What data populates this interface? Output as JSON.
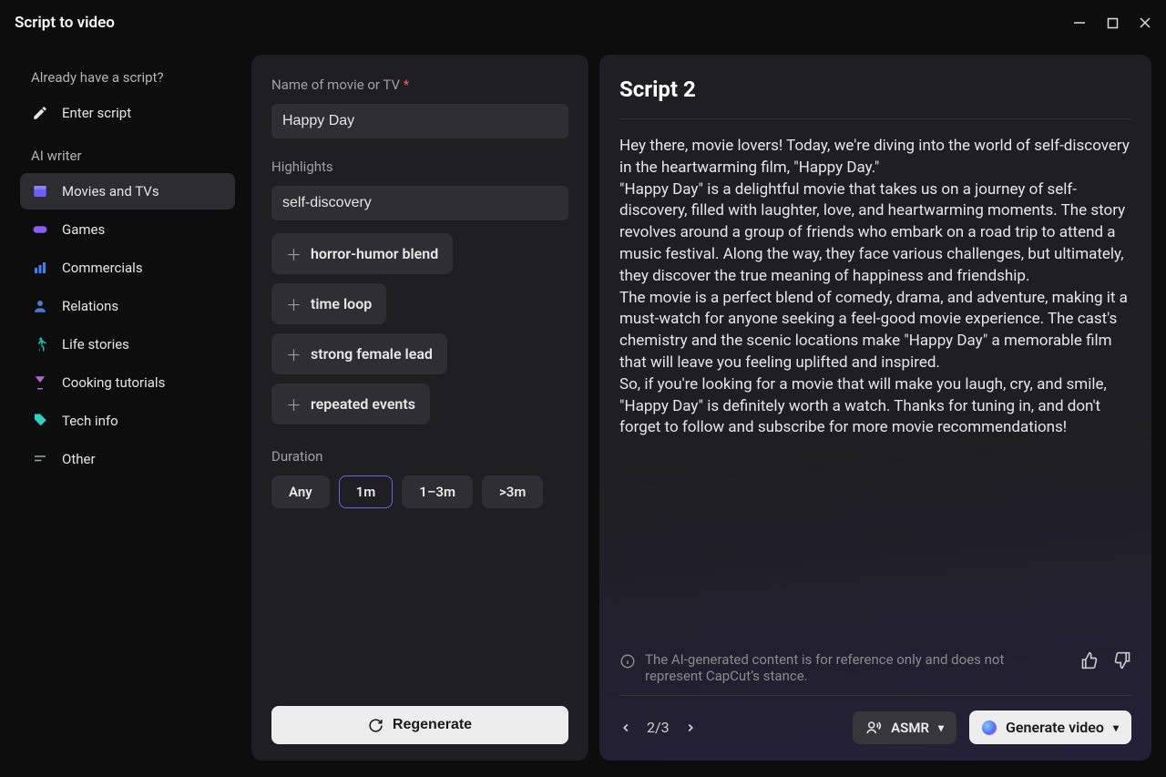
{
  "app": {
    "title": "Script to video"
  },
  "sidebar": {
    "heading_script": "Already have a script?",
    "enter_script": "Enter script",
    "heading_ai": "AI writer",
    "items": [
      {
        "label": "Movies and TVs",
        "icon": "clapper",
        "active": true
      },
      {
        "label": "Games",
        "icon": "gamepad",
        "active": false
      },
      {
        "label": "Commercials",
        "icon": "chart",
        "active": false
      },
      {
        "label": "Relations",
        "icon": "person",
        "active": false
      },
      {
        "label": "Life stories",
        "icon": "walking",
        "active": false
      },
      {
        "label": "Cooking tutorials",
        "icon": "cocktail",
        "active": false
      },
      {
        "label": "Tech info",
        "icon": "tag",
        "active": false
      },
      {
        "label": "Other",
        "icon": "lines",
        "active": false
      }
    ]
  },
  "form": {
    "name_label": "Name of movie or TV",
    "name_value": "Happy Day",
    "highlights_label": "Highlights",
    "highlights_value": "self-discovery",
    "chips": [
      "horror-humor blend",
      "time loop",
      "strong female lead",
      "repeated events"
    ],
    "duration_label": "Duration",
    "durations": [
      {
        "label": "Any",
        "selected": false
      },
      {
        "label": "1m",
        "selected": true
      },
      {
        "label": "1–3m",
        "selected": false
      },
      {
        "label": ">3m",
        "selected": false
      }
    ],
    "regenerate": "Regenerate"
  },
  "script": {
    "title": "Script 2",
    "body": "Hey there, movie lovers! Today, we're diving into the world of self-discovery in the heartwarming film, \"Happy Day.\"\n\"Happy Day\" is a delightful movie that takes us on a journey of self-discovery, filled with laughter, love, and heartwarming moments. The story revolves around a group of friends who embark on a road trip to attend a music festival. Along the way, they face various challenges, but ultimately, they discover the true meaning of happiness and friendship.\nThe movie is a perfect blend of comedy, drama, and adventure, making it a must-watch for anyone seeking a feel-good movie experience. The cast's chemistry and the scenic locations make \"Happy Day\" a memorable film that will leave you feeling uplifted and inspired.\nSo, if you're looking for a movie that will make you laugh, cry, and smile, \"Happy Day\" is definitely worth a watch. Thanks for tuning in, and don't forget to follow and subscribe for more movie recommendations!",
    "disclaimer": "The AI-generated content is for reference only and does not represent CapCut’s stance.",
    "pager": "2/3",
    "voice_label": "ASMR",
    "generate_label": "Generate video"
  }
}
